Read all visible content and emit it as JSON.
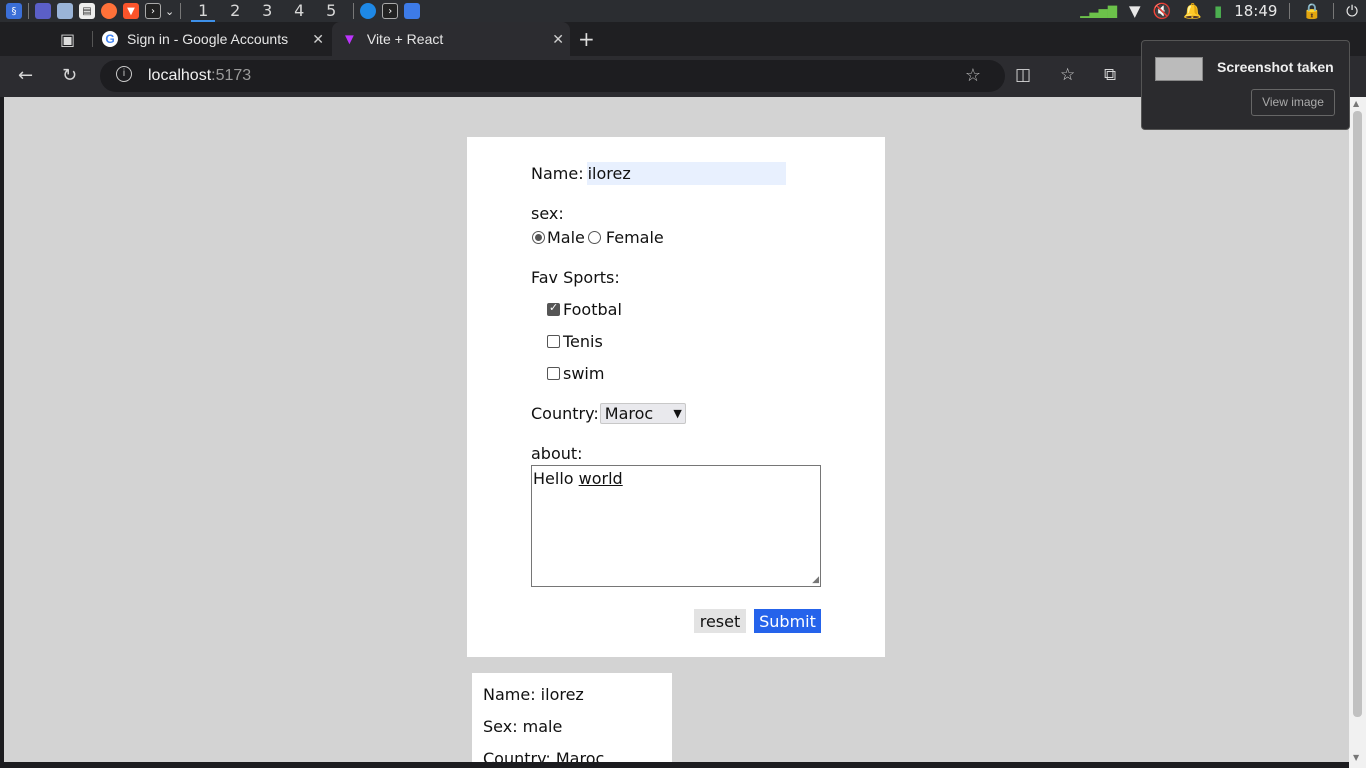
{
  "taskbar": {
    "workspaces": [
      "1",
      "2",
      "3",
      "4",
      "5"
    ],
    "active_workspace": "1",
    "clock": "18:49"
  },
  "tabs": [
    {
      "title": "Sign in - Google Accounts"
    },
    {
      "title": "Vite + React"
    }
  ],
  "address": {
    "host": "localhost",
    "port": ":5173"
  },
  "form": {
    "name_label": "Name:",
    "name_value": "ilorez",
    "sex_label": "sex:",
    "sex_options": [
      "Male",
      "Female"
    ],
    "sex_selected": "Male",
    "sports_label": "Fav Sports:",
    "sports": [
      {
        "label": "Footbal",
        "checked": true
      },
      {
        "label": "Tenis",
        "checked": false
      },
      {
        "label": "swim",
        "checked": false
      }
    ],
    "country_label": "Country:",
    "country_value": "Maroc",
    "about_label": "about:",
    "about_word1": "Hello",
    "about_word2": "world",
    "reset_label": "reset",
    "submit_label": "Submit"
  },
  "result": {
    "name_line": "Name: ilorez",
    "sex_line": "Sex: male",
    "country_line": "Country: Maroc"
  },
  "notification": {
    "title": "Screenshot taken",
    "action": "View image"
  },
  "colors": {
    "submit": "#2563eb",
    "autofill": "#e8f0fe",
    "page_bg": "#d3d3d3"
  }
}
